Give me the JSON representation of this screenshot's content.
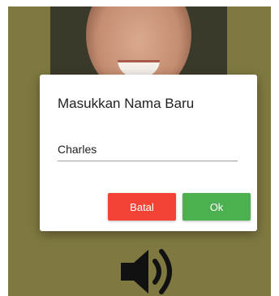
{
  "dialog": {
    "title": "Masukkan Nama Baru",
    "name_value": "Charles",
    "cancel_label": "Batal",
    "ok_label": "Ok"
  },
  "icons": {
    "speaker": "speaker-icon"
  },
  "colors": {
    "background": "#7f7941",
    "cancel_button": "#f44336",
    "ok_button": "#4caf50"
  }
}
